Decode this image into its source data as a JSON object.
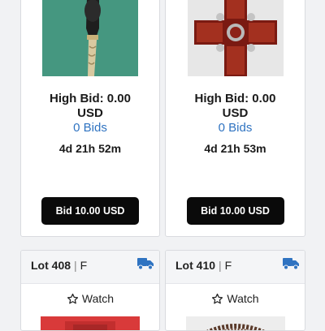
{
  "cards": [
    {
      "high_bid": "High Bid: 0.00",
      "currency": "USD",
      "bids": "0 Bids",
      "time_left": "4d 21h 52m",
      "bid_button": "Bid 10.00 USD",
      "image": "walking-cane-carved-handle"
    },
    {
      "high_bid": "High Bid: 0.00",
      "currency": "USD",
      "bids": "0 Bids",
      "time_left": "4d 21h 53m",
      "bid_button": "Bid 10.00 USD",
      "image": "red-stone-cross-brooch"
    }
  ],
  "lots": [
    {
      "lot": "Lot 408",
      "separator": "|",
      "tag": "F",
      "watch": "Watch",
      "shipping_icon": "truck-icon",
      "image": "red-leather-item"
    },
    {
      "lot": "Lot 410",
      "separator": "|",
      "tag": "F",
      "watch": "Watch",
      "shipping_icon": "truck-icon",
      "image": "brown-beaded-necklace"
    }
  ],
  "colors": {
    "link": "#2f73c1",
    "truck": "#2f73c1",
    "button": "#0a0a0a"
  }
}
